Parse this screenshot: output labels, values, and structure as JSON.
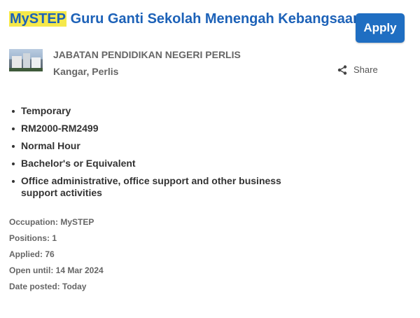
{
  "job": {
    "title_highlight": "MySTEP",
    "title_rest": " Guru Ganti Sekolah Menengah Kebangsaan Abi",
    "apply_label": "Apply",
    "employer": "JABATAN PENDIDIKAN NEGERI PERLIS",
    "location": "Kangar, Perlis",
    "share_label": "Share"
  },
  "details": [
    "Temporary",
    "RM2000-RM2499",
    "Normal Hour",
    "Bachelor's or Equivalent",
    "Office administrative, office support and other business support activities"
  ],
  "meta": {
    "occupation": "Occupation: MySTEP",
    "positions": "Positions: 1",
    "applied": "Applied: 76",
    "open_until": "Open until: 14 Mar 2024",
    "date_posted": "Date posted: Today"
  },
  "colors": {
    "title": "#1d62b8",
    "highlight": "#f5e84a",
    "apply_button": "#1f6ec2"
  },
  "icons": {
    "share": "share-icon",
    "employer_logo": "employer-logo"
  }
}
